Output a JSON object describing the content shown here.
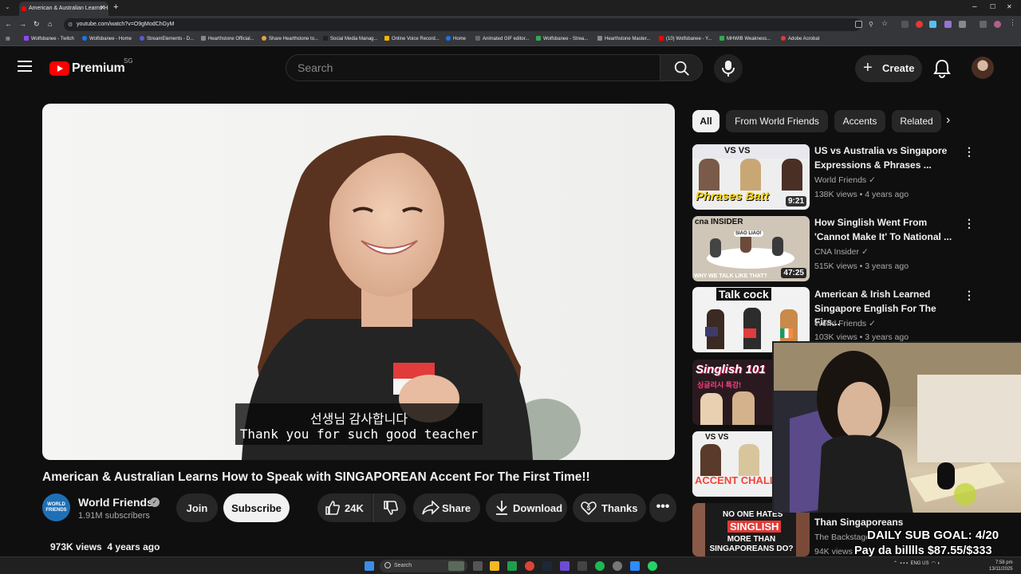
{
  "browser": {
    "tab_title": "American & Australian Learns H",
    "url": "youtube.com/watch?v=O9gModChGyM",
    "bookmarks": [
      "Wolfsbanee - Twitch",
      "Wolfsbanee - Home",
      "StreamElements - D...",
      "Hearthstone Official...",
      "Share Hearthstone to...",
      "Social Media Manag...",
      "Online Voice Record...",
      "Home",
      "Animated GIF editor...",
      "Wolfsbanee - Strea...",
      "Hearthstone Master...",
      "(10) Wolfsbanee - Y...",
      "MHWIB Weakness...",
      "Adobe Acrobat"
    ]
  },
  "header": {
    "logo_text": "Premium",
    "region": "SG",
    "search_placeholder": "Search",
    "create_label": "Create"
  },
  "player": {
    "subtitle_ko": "선생님 감사합니다",
    "subtitle_en": "Thank you for such good teacher"
  },
  "video": {
    "title": "American & Australian Learns How to Speak with SINGAPOREAN Accent For The First Time!!",
    "channel_avatar_text": "WORLD FRIENDS",
    "channel_name": "World Friends",
    "subscribers": "1.91M subscribers",
    "join_label": "Join",
    "subscribe_label": "Subscribe",
    "likes": "24K",
    "share_label": "Share",
    "download_label": "Download",
    "thanks_label": "Thanks",
    "views": "973K views",
    "age": "4 years ago"
  },
  "chips": [
    "All",
    "From World Friends",
    "Accents",
    "Related"
  ],
  "related": [
    {
      "title": "US vs Australia vs Singapore Expressions & Phrases ...",
      "channel": "World Friends",
      "meta": "138K views • 4 years ago",
      "duration": "9:21",
      "thumb_text": "Phrases Batt",
      "thumb_top": "VS    VS"
    },
    {
      "title": "How Singlish Went From 'Cannot Make It' To National ...",
      "channel": "CNA Insider",
      "meta": "515K views • 3 years ago",
      "duration": "47:25",
      "thumb_text": "WHY WE TALK LIKE THAT?",
      "thumb_top": "cna INSIDER",
      "thumb_bubble": "SIAO LIAO!"
    },
    {
      "title": "American & Irish Learned Singapore English For The Firs...",
      "channel": "World Friends",
      "meta": "103K views • 3 years ago",
      "thumb_text": "Talk cock"
    },
    {
      "thumb_text": "Singlish 101",
      "thumb_sub": "싱글리시 특강!"
    },
    {
      "thumb_text": "ACCENT CHALL",
      "thumb_top": "VS    VS"
    },
    {
      "title": "Than Singaporeans",
      "channel": "The Backstage",
      "meta": "94K views",
      "thumb_text": "MORE THAN SINGAPOREANS DO?",
      "thumb_top": "NO ONE HATES",
      "thumb_mid": "SINGLISH"
    }
  ],
  "overlay": {
    "goal": "DAILY SUB GOAL: 4/20",
    "bills": "Pay da billlls $87.55/$333"
  },
  "taskbar": {
    "search_label": "Search",
    "lang": "ENG US",
    "time": "7:58 pm",
    "date": "13/11/2025"
  },
  "colors": {
    "background": "#0f0f0f",
    "brand_red": "#ff0000",
    "chip": "#272727",
    "text_secondary": "#aaaaaa"
  }
}
